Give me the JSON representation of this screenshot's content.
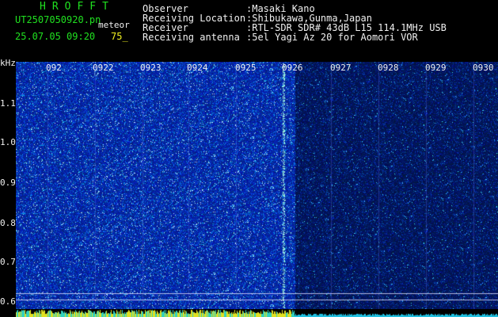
{
  "header": {
    "brand": "HROFFT",
    "filename": "UT2507050920.pn",
    "tag": "meteor",
    "datetime": "25.07.05 09:20",
    "count": "75_",
    "fields": [
      {
        "label": "Observer",
        "value": ":Masaki Kano"
      },
      {
        "label": "Receiving Location",
        "value": ":Shibukawa,Gunma,Japan"
      },
      {
        "label": "Receiver",
        "value": ":RTL-SDR SDR# 43dB L15 114.1MHz USB"
      },
      {
        "label": "Receiving antenna",
        "value": ":5el Yagi Az 20 for Aomori VOR"
      }
    ]
  },
  "xticks": [
    "092",
    "0922",
    "0923",
    "0924",
    "0925",
    "0926",
    "0927",
    "0928",
    "0929",
    "0930"
  ],
  "yaxis": {
    "unit": "kHz",
    "ticks": [
      "1.1",
      "1.0",
      "0.9",
      "0.8",
      "0.7",
      "0.6"
    ]
  },
  "colors": {
    "background": "#000000",
    "label": "#20e020",
    "text": "#f0f0f0",
    "count": "#f0f020",
    "noise_base": "#0a1a9a",
    "noise_dark": "#061060"
  }
}
